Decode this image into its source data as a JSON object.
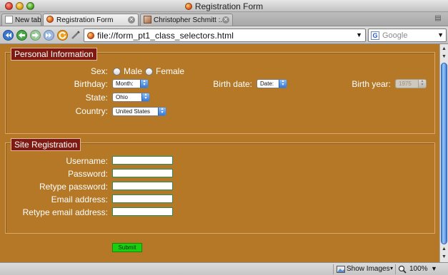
{
  "window": {
    "title": "Registration Form"
  },
  "tabs": [
    {
      "label": "New tab"
    },
    {
      "label": "Registration Form"
    },
    {
      "label": "Christopher Schmitt :..."
    }
  ],
  "nav": {
    "url": "file://form_pt1_class_selectors.html",
    "search_placeholder": "Google"
  },
  "personal": {
    "legend": "Personal Information",
    "sex_label": "Sex:",
    "sex_options": [
      "Male",
      "Female"
    ],
    "birthday_label": "Birthday:",
    "birthday_value": "Month:",
    "birthdate_label": "Birth date:",
    "birthdate_value": "Date:",
    "birthyear_label": "Birth year:",
    "birthyear_value": "1975",
    "state_label": "State:",
    "state_value": "Ohio",
    "country_label": "Country:",
    "country_value": "United States"
  },
  "registration": {
    "legend": "Site Registration",
    "fields": [
      "Username:",
      "Password:",
      "Retype password:",
      "Email address:",
      "Retype email address:"
    ]
  },
  "submit_label": "Submit",
  "status": {
    "show_images": "Show Images",
    "zoom": "100%"
  },
  "colors": {
    "page_bg": "#b47826",
    "legend_bg": "#7e1a12",
    "submit_bg": "#18d010"
  }
}
